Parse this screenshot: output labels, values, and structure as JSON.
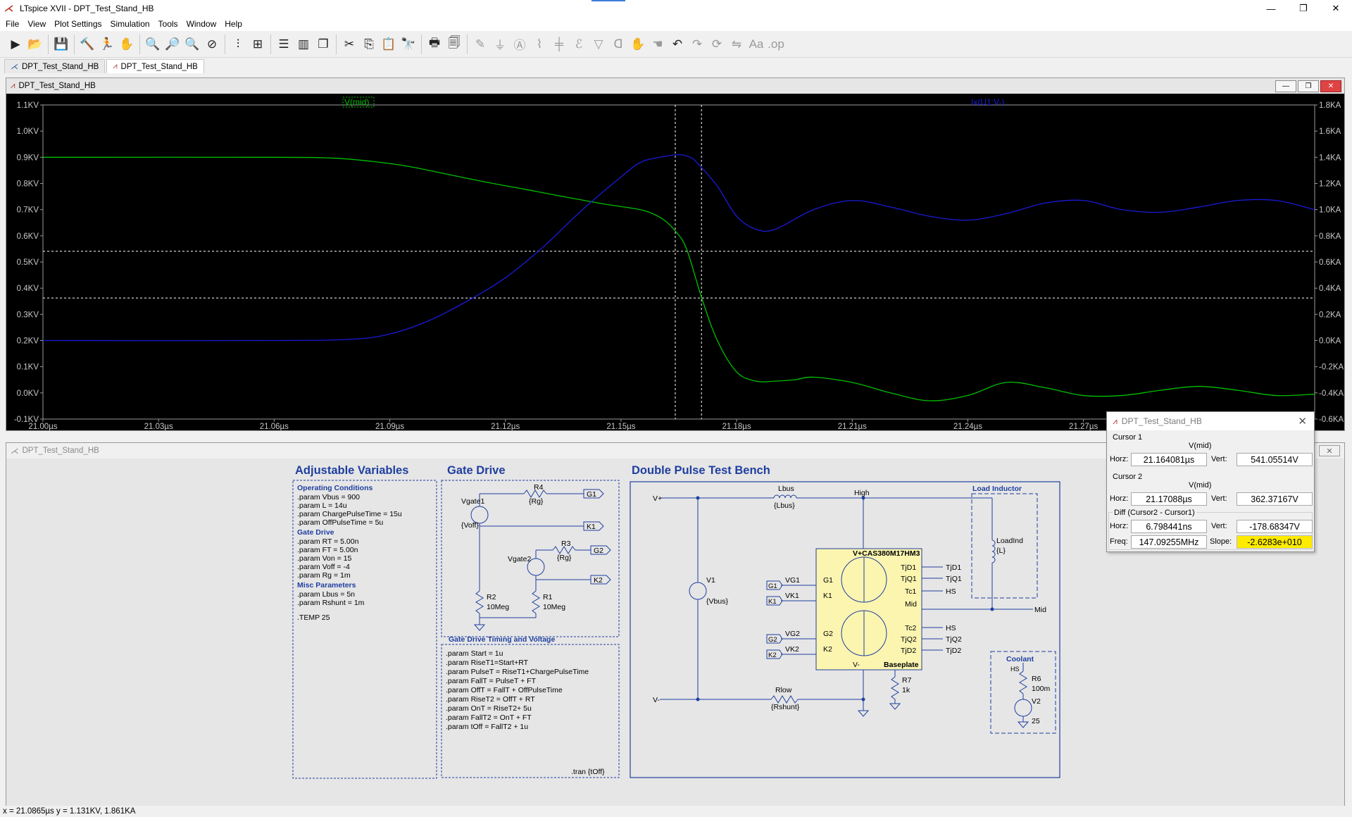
{
  "app": {
    "title": "LTspice XVII - DPT_Test_Stand_HB",
    "window_buttons": {
      "minimize": "—",
      "maximize": "❐",
      "close": "✕"
    }
  },
  "menu": [
    "File",
    "View",
    "Plot Settings",
    "Simulation",
    "Tools",
    "Window",
    "Help"
  ],
  "toolbar": {
    "icons": [
      "new-schematic",
      "open",
      "save",
      "control-panel",
      "run",
      "halt",
      "zoom-in",
      "zoom-pan",
      "zoom-out",
      "zoom-fit",
      "autorange-y",
      "mark-data",
      "tile-horizontal",
      "tile-vertical",
      "cascade",
      "cut",
      "copy",
      "paste",
      "find",
      "print",
      "print-preview",
      "wire",
      "ground",
      "label-net",
      "resistor",
      "capacitor",
      "inductor",
      "diode",
      "component",
      "move",
      "drag",
      "undo",
      "redo",
      "rotate",
      "mirror",
      "text",
      "spice-directive"
    ]
  },
  "tabs": [
    {
      "label": "DPT_Test_Stand_HB",
      "kind": "schematic",
      "active": false
    },
    {
      "label": "DPT_Test_Stand_HB",
      "kind": "waveform",
      "active": true
    }
  ],
  "plot_window": {
    "title": "DPT_Test_Stand_HB",
    "trace1_label": "V(mid)",
    "trace2_label": "Ix(U1:V-)",
    "colors": {
      "background": "#000000",
      "trace1": "#00c000",
      "trace2": "#1a1ad8",
      "grid": "#ffffff"
    }
  },
  "chart_data": {
    "type": "line",
    "title": "",
    "xlabel": "",
    "x_ticks": [
      "21.00µs",
      "21.03µs",
      "21.06µs",
      "21.09µs",
      "21.12µs",
      "21.15µs",
      "21.18µs",
      "21.21µs",
      "21.24µs",
      "21.27µs"
    ],
    "y_left_ticks": [
      "1.1KV",
      "1.0KV",
      "0.9KV",
      "0.8KV",
      "0.7KV",
      "0.6KV",
      "0.5KV",
      "0.4KV",
      "0.3KV",
      "0.2KV",
      "0.1KV",
      "0.0KV",
      "-0.1KV"
    ],
    "y_right_ticks": [
      "1.8KA",
      "1.6KA",
      "1.4KA",
      "1.2KA",
      "1.0KA",
      "0.8KA",
      "0.6KA",
      "0.4KA",
      "0.2KA",
      "0.0KA",
      "-0.2KA",
      "-0.4KA",
      "-0.6KA"
    ],
    "xlim": [
      21.0,
      21.33
    ],
    "ylim_left": [
      -0.1,
      1.1
    ],
    "ylim_right": [
      -0.6,
      1.8
    ],
    "series": [
      {
        "name": "V(mid)",
        "axis": "left",
        "unit": "KV",
        "x": [
          21.0,
          21.06,
          21.075,
          21.085,
          21.095,
          21.105,
          21.115,
          21.125,
          21.135,
          21.145,
          21.15,
          21.155,
          21.158,
          21.161,
          21.164,
          21.167,
          21.171,
          21.175,
          21.18,
          21.185,
          21.19,
          21.195,
          21.2,
          21.21,
          21.22,
          21.23,
          21.24,
          21.25,
          21.26,
          21.27,
          21.28,
          21.29,
          21.3,
          21.31,
          21.32,
          21.33
        ],
        "y": [
          0.9,
          0.9,
          0.897,
          0.885,
          0.865,
          0.835,
          0.805,
          0.778,
          0.75,
          0.723,
          0.712,
          0.7,
          0.686,
          0.662,
          0.62,
          0.55,
          0.36,
          0.2,
          0.08,
          0.045,
          0.045,
          0.05,
          0.06,
          0.04,
          0.0,
          -0.03,
          -0.01,
          0.04,
          0.02,
          -0.01,
          -0.01,
          0.01,
          0.025,
          0.01,
          -0.01,
          -0.005
        ]
      },
      {
        "name": "Ix(U1:V-)",
        "axis": "right",
        "unit": "KA",
        "x": [
          21.0,
          21.06,
          21.08,
          21.09,
          21.1,
          21.11,
          21.12,
          21.13,
          21.14,
          21.15,
          21.155,
          21.16,
          21.165,
          21.168,
          21.17,
          21.175,
          21.18,
          21.185,
          21.19,
          21.2,
          21.21,
          21.22,
          21.23,
          21.24,
          21.25,
          21.26,
          21.27,
          21.28,
          21.29,
          21.3,
          21.31,
          21.32,
          21.33
        ],
        "y": [
          0.0,
          0.0,
          0.01,
          0.05,
          0.15,
          0.3,
          0.48,
          0.72,
          1.0,
          1.25,
          1.36,
          1.4,
          1.42,
          1.4,
          1.35,
          1.18,
          0.95,
          0.85,
          0.85,
          1.0,
          1.07,
          1.02,
          0.95,
          0.92,
          0.97,
          1.05,
          1.07,
          1.0,
          0.98,
          1.02,
          1.07,
          1.07,
          1.0
        ]
      }
    ],
    "cursors_x": [
      21.164081,
      21.17088
    ],
    "cursors_y_left": [
      0.541055,
      0.362372
    ],
    "grid": true
  },
  "cursor_dialog": {
    "title": "DPT_Test_Stand_HB",
    "cursor1_label": "Cursor 1",
    "cursor1_trace": "V(mid)",
    "cursor1_horz": "21.164081µs",
    "cursor1_vert": "541.05514V",
    "cursor2_label": "Cursor 2",
    "cursor2_trace": "V(mid)",
    "cursor2_horz": "21.17088µs",
    "cursor2_vert": "362.37167V",
    "diff_label": "Diff (Cursor2 - Cursor1)",
    "diff_horz": "6.798441ns",
    "diff_vert": "-178.68347V",
    "freq": "147.09255MHz",
    "slope": "-2.6283e+010",
    "labels": {
      "horz": "Horz:",
      "vert": "Vert:",
      "freq": "Freq:",
      "slope": "Slope:"
    }
  },
  "schematic_window": {
    "title": "DPT_Test_Stand_HB",
    "adjustable": {
      "heading": "Adjustable Variables",
      "sec1": "Operating Conditions",
      "l1": ".param Vbus = 900",
      "l2": ".param L = 14u",
      "l3": ".param ChargePulseTime = 15u",
      "l4": ".param OffPulseTime = 5u",
      "sec2": "Gate Drive",
      "l5": ".param RT = 5.00n",
      "l6": ".param FT = 5.00n",
      "l7": ".param Von = 15",
      "l8": ".param Voff = -4",
      "l9": ".param Rg = 1m",
      "sec3": "Misc Parameters",
      "l10": ".param Lbus = 5n",
      "l11": ".param Rshunt = 1m",
      "l12": ".TEMP 25"
    },
    "gate_drive": {
      "heading": "Gate Drive",
      "vgate1": "Vgate1",
      "voff": "{Voff}",
      "r4": "R4",
      "rg1": "{Rg}",
      "g1": "G1",
      "k1": "K1",
      "r3": "R3",
      "rg2": "{Rg}",
      "g2": "G2",
      "vgate2": "Vgate2",
      "k2": "K2",
      "r2": "R2",
      "r2v": "10Meg",
      "r1": "R1",
      "r1v": "10Meg"
    },
    "timing": {
      "heading": "Gate Drive Timing and Voltage",
      "t1": ".param Start = 1u",
      "t2": ".param RiseT1=Start+RT",
      "t3": ".param PulseT = RiseT1+ChargePulseTime",
      "t4": ".param FallT = PulseT + FT",
      "t5": ".param OffT = FallT + OffPulseTime",
      "t6": ".param RiseT2 = OffT + RT",
      "t7": ".param OnT = RiseT2+  5u",
      "t8": ".param FallT2 = OnT + FT",
      "t9": ".param tOff = FallT2 + 1u",
      "tran": ".tran {tOff}"
    },
    "bench": {
      "heading": "Double Pulse Test Bench",
      "vplus": "V+",
      "vminus": "V-",
      "lbus": "Lbus",
      "lbusv": "{Lbus}",
      "high": "High",
      "load_inductor": "Load Inductor",
      "loadind": "LoadInd",
      "loadind_v": "{L}",
      "v1": "V1",
      "vbus": "{Vbus}",
      "module": "V+CAS380M17HM3",
      "vg1": "VG1",
      "g1": "G1",
      "vk1": "VK1",
      "k1": "K1",
      "vg2": "VG2",
      "g2": "G2",
      "vk2": "VK2",
      "k2": "K2",
      "tjd1": "TjD1",
      "tjq1": "TjQ1",
      "tc1": "Tc1",
      "mid": "Mid",
      "tc2": "Tc2",
      "tjq2": "TjQ2",
      "tjd2": "TjD2",
      "vm": "V-",
      "baseplate": "Baseplate",
      "hs": "HS",
      "rlow": "Rlow",
      "rshunt": "{Rshunt}",
      "r7": "R7",
      "r7v": "1k",
      "coolant": "Coolant",
      "r6": "R6",
      "r6v": "100m",
      "v2": "V2",
      "v2v": "25",
      "net_g1": "G1",
      "net_k1": "K1",
      "net_g2": "G2",
      "net_k2": "K2",
      "net_mid": "Mid",
      "net_hs": "HS"
    }
  },
  "status": "x = 21.0865µs   y = 1.131KV, 1.861KA"
}
